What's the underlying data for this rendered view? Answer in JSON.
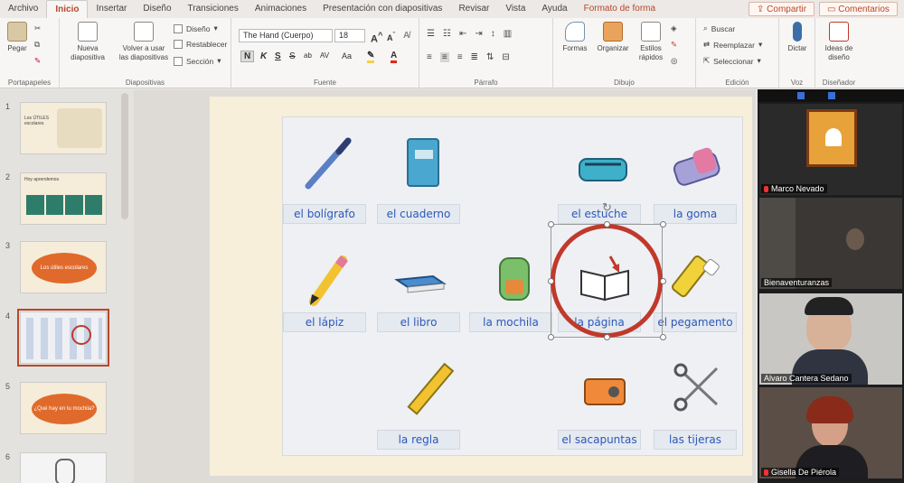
{
  "ribbon": {
    "tabs": [
      "Archivo",
      "Inicio",
      "Insertar",
      "Diseño",
      "Transiciones",
      "Animaciones",
      "Presentación con diapositivas",
      "Revisar",
      "Vista",
      "Ayuda",
      "Formato de forma"
    ],
    "share_label": "Compartir",
    "comments_label": "Comentarios",
    "clipboard": {
      "paste": "Pegar",
      "group": "Portapapeles"
    },
    "slides": {
      "new_slide_l1": "Nueva",
      "new_slide_l2": "diapositiva",
      "reuse_l1": "Volver a usar",
      "reuse_l2": "las diapositivas",
      "layout": "Diseño",
      "reset": "Restablecer",
      "section": "Sección",
      "group": "Diapositivas"
    },
    "font": {
      "name": "The Hand (Cuerpo)",
      "size": "18",
      "bold": "N",
      "italic": "K",
      "underline": "S",
      "strike": "S",
      "spacing": "AV",
      "case": "Aa",
      "group": "Fuente"
    },
    "paragraph": {
      "group": "Párrafo"
    },
    "drawing": {
      "shapes": "Formas",
      "arrange": "Organizar",
      "quick_styles_l1": "Estilos",
      "quick_styles_l2": "rápidos",
      "group": "Dibujo"
    },
    "editing": {
      "find": "Buscar",
      "replace": "Reemplazar",
      "select": "Seleccionar",
      "group": "Edición"
    },
    "voice": {
      "dictate": "Dictar",
      "group": "Voz"
    },
    "designer": {
      "ideas_l1": "Ideas de",
      "ideas_l2": "diseño",
      "group": "Diseñador"
    }
  },
  "thumbnails": [
    {
      "num": "1",
      "text": "Los ÚTILES escolares"
    },
    {
      "num": "2",
      "text": "Hoy aprendemos"
    },
    {
      "num": "3",
      "text": "Los útiles escolares"
    },
    {
      "num": "4",
      "text": ""
    },
    {
      "num": "5",
      "text": "¿Qué hay en tu mochila?"
    },
    {
      "num": "6",
      "text": ""
    }
  ],
  "slide": {
    "items": [
      {
        "label": "el bolígrafo",
        "icon": "pen-icon"
      },
      {
        "label": "el cuaderno",
        "icon": "notebook-icon"
      },
      {
        "label": "el estuche",
        "icon": "pencil-case-icon"
      },
      {
        "label": "la goma",
        "icon": "eraser-icon"
      },
      {
        "label": "el lápiz",
        "icon": "pencil-icon"
      },
      {
        "label": "el libro",
        "icon": "book-icon"
      },
      {
        "label": "la mochila",
        "icon": "backpack-icon"
      },
      {
        "label": "la página",
        "icon": "open-book-icon"
      },
      {
        "label": "el pegamento",
        "icon": "glue-stick-icon"
      },
      {
        "label": "la regla",
        "icon": "ruler-icon"
      },
      {
        "label": "el sacapuntas",
        "icon": "sharpener-icon"
      },
      {
        "label": "las tijeras",
        "icon": "scissors-icon"
      }
    ]
  },
  "participants": [
    {
      "name": "Marco Nevado"
    },
    {
      "name": "Bienaventuranzas"
    },
    {
      "name": "Alvaro Cantera Sedano"
    },
    {
      "name": "Gisella De Piérola"
    }
  ],
  "colors": {
    "accent": "#b7472a",
    "label_text": "#2b58b8",
    "highlight_circle": "#c0392b"
  }
}
